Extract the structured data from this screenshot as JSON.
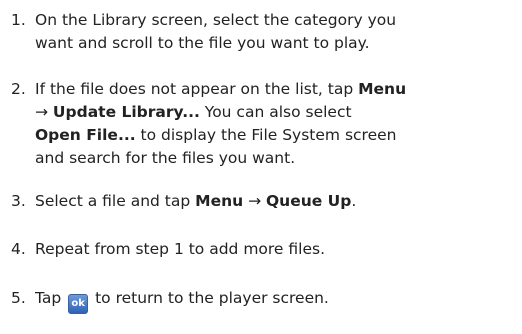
{
  "steps": [
    {
      "number": "1.",
      "lines": [
        "On the Library screen, select the category you",
        "want and scroll to the file you want to play."
      ]
    },
    {
      "number": "2.",
      "line1_a": "If the file does not appear on the list, tap ",
      "line1_b": "Menu",
      "line2_arrow": "→ ",
      "line2_b": "Update Library...",
      "line2_c": " You can also select",
      "line3_b": "Open File...",
      "line3_c": " to display the File System screen",
      "line4": "and search for the files you want."
    },
    {
      "number": "3.",
      "a": "Select a file and tap ",
      "b": "Menu",
      "c": " → ",
      "d": "Queue Up",
      "e": "."
    },
    {
      "number": "4.",
      "text": "Repeat from step 1 to add more files."
    },
    {
      "number": "5.",
      "a": "Tap ",
      "icon": "ok-icon",
      "icon_glyph": "ok",
      "b": " to return to the player screen."
    }
  ]
}
